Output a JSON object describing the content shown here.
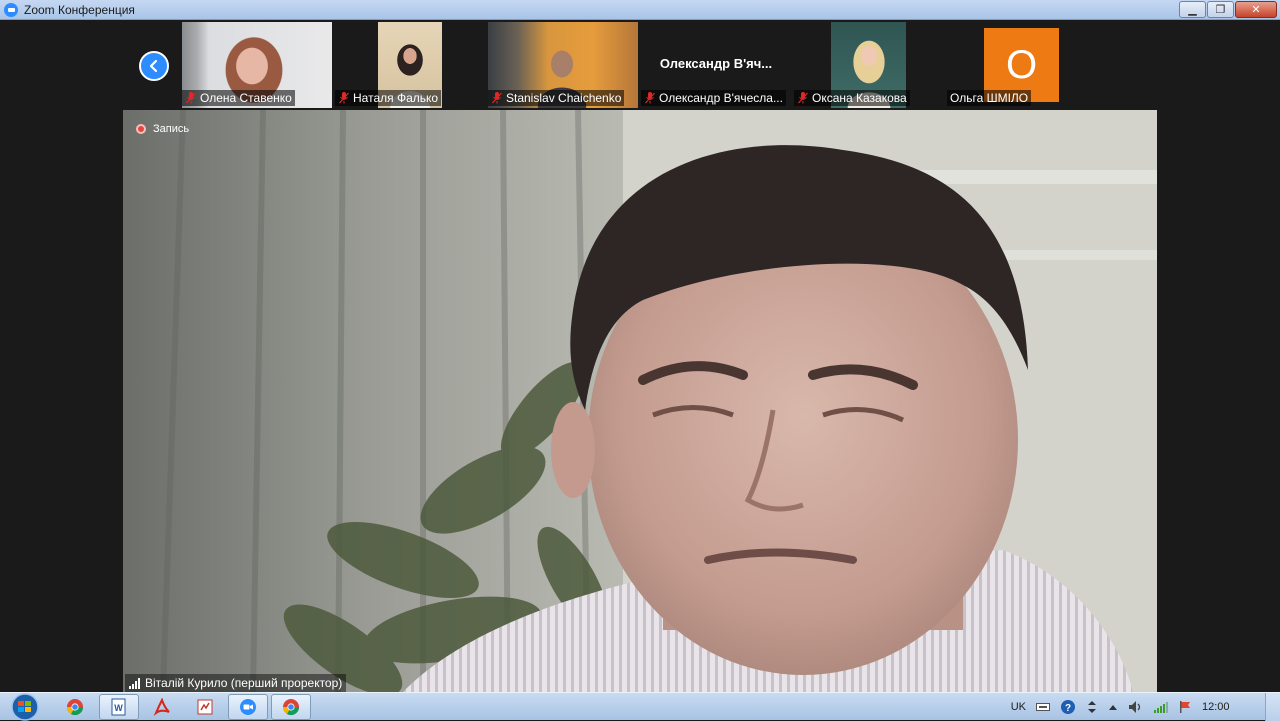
{
  "window": {
    "title": "Zoom Конференция",
    "icon": "zoom-icon"
  },
  "gallery": {
    "tiles": [
      {
        "name": "Олена Ставенко",
        "muted": true
      },
      {
        "name": "Наталя Фалько",
        "muted": true
      },
      {
        "name": "Stanislav Chaichenko",
        "muted": true
      },
      {
        "name": "Олександр В'ячесла...",
        "display_name": "Олександр  В'яч...",
        "muted": true
      },
      {
        "name": "Оксана Казакова",
        "muted": true
      },
      {
        "name": "Ольга ШМІЛО",
        "avatar_letter": "О",
        "avatar_color": "#ED7A12",
        "muted": false
      }
    ]
  },
  "main": {
    "recording_label": "Запись",
    "speaker_name": "Віталій Курило (перший проректор)"
  },
  "taskbar": {
    "apps": [
      "chrome-icon",
      "word-icon",
      "acrobat-icon",
      "pdf-icon",
      "zoom-icon",
      "chrome-icon"
    ],
    "active_app": "zoom-icon",
    "tray": {
      "language": "UK",
      "clock": "12:00"
    }
  },
  "colors": {
    "zoom_blue": "#2D8CFF",
    "muted_red": "#E02828",
    "record_red": "#E8453C"
  }
}
